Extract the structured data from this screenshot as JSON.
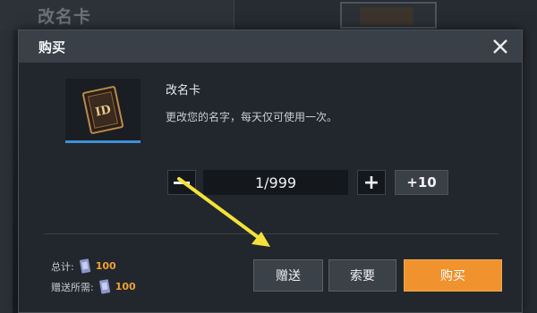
{
  "background": {
    "title": "改名卡"
  },
  "dialog": {
    "title": "购买",
    "close_icon": "close-icon"
  },
  "item": {
    "name": "改名卡",
    "description": "更改您的名字，每天仅可使用一次。",
    "icon": "id-card-icon",
    "icon_label": "ID"
  },
  "quantity": {
    "value": "1/999",
    "minus_icon": "minus-icon",
    "plus_label": "+",
    "plus10_label": "+10"
  },
  "totals": {
    "total_label": "总计:",
    "total_value": "100",
    "gift_label": "赠送所需:",
    "gift_value": "100",
    "currency_icon": "coupon-icon"
  },
  "actions": {
    "gift": "赠送",
    "request": "索要",
    "buy": "购买"
  },
  "colors": {
    "accent_buy": "#f0922d",
    "price": "#f0a030",
    "selected_underline": "#3f8fd6",
    "annotation_arrow": "#f4e23a"
  }
}
